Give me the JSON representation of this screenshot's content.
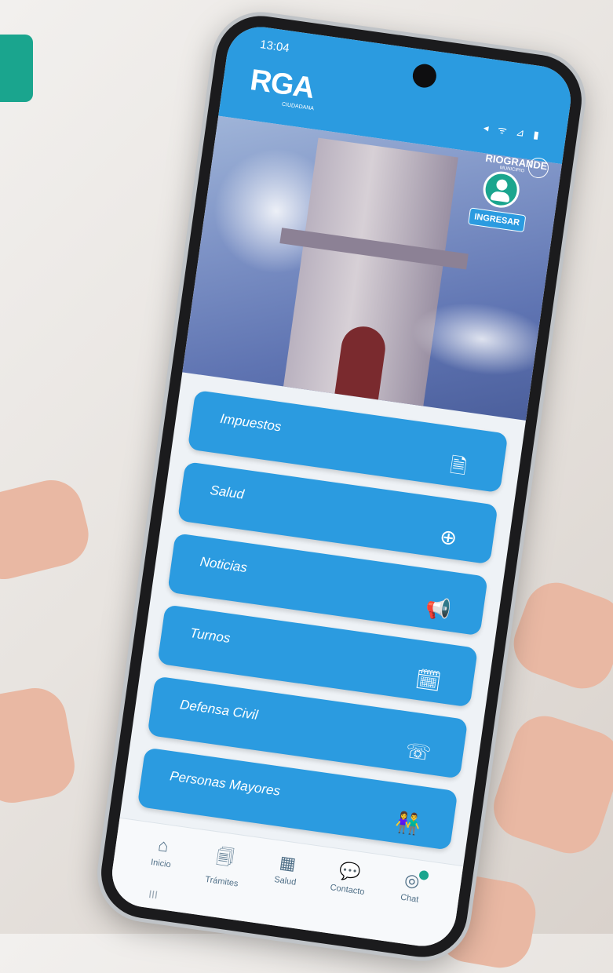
{
  "status_bar": {
    "time": "13:04",
    "icons": "◂ ᯤ ⊿ ▮"
  },
  "brand": {
    "logo": "RGA",
    "logo_sub": "CIUDADANA",
    "municipality": "RIOGRANDE",
    "municipality_sub": "MUNICIPIO"
  },
  "login": {
    "label": "INGRESAR",
    "icon": "user-avatar-icon"
  },
  "menu": [
    {
      "label": "Impuestos",
      "icon": "tax-document-icon",
      "glyph": "🗎"
    },
    {
      "label": "Salud",
      "icon": "health-plus-icon",
      "glyph": "⊕"
    },
    {
      "label": "Noticias",
      "icon": "megaphone-icon",
      "glyph": "📢"
    },
    {
      "label": "Turnos",
      "icon": "calendar-icon",
      "glyph": "🗓"
    },
    {
      "label": "Defensa Civil",
      "icon": "phone-icon",
      "glyph": "☏"
    },
    {
      "label": "Personas Mayores",
      "icon": "elderly-people-icon",
      "glyph": "👫"
    }
  ],
  "bottom_nav": [
    {
      "label": "Inicio",
      "icon": "home-icon",
      "glyph": "⌂"
    },
    {
      "label": "Trámites",
      "icon": "document-icon",
      "glyph": "🗐"
    },
    {
      "label": "Salud",
      "icon": "health-building-icon",
      "glyph": "▦"
    },
    {
      "label": "Contacto",
      "icon": "chat-icon",
      "glyph": "💬"
    },
    {
      "label": "Chat",
      "icon": "chat-bot-icon",
      "glyph": "◎"
    }
  ],
  "system_nav": {
    "recents": "III"
  },
  "colors": {
    "primary": "#2b9be0",
    "accent": "#1aa58e",
    "background": "#eef2f6"
  }
}
